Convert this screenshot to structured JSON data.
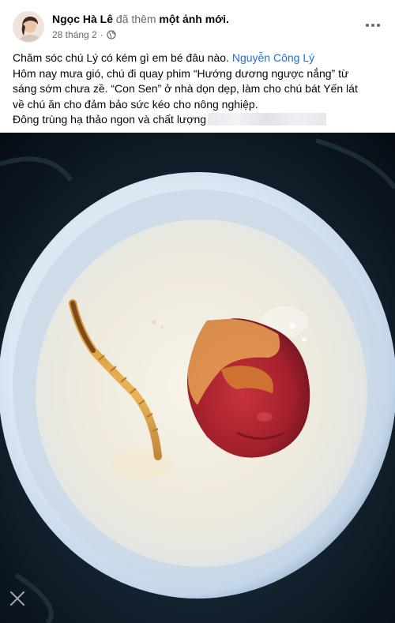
{
  "post": {
    "author": "Ngọc Hà Lê",
    "action_prefix": "đã thêm",
    "action_bold": "một ảnh mới.",
    "date": "28 tháng 2",
    "separator": "·",
    "audience_icon": "globe-icon",
    "more_icon": "more-horizontal-icon",
    "text": {
      "line1": "Chăm sóc chú Lý có kém gì em bé đâu nào.",
      "mention": "Nguyễn Công Lý",
      "line2": "Hôm nay mưa gió, chú đi quay phim “Hướng dương ngược nắng” từ",
      "line3": "sáng sớm chưa zề. “Con Sen” ở nhà dọn dẹp, làm cho chú bát Yến lát",
      "line4": "về chú ăn cho đảm bảo sức kéo cho nông nghiệp.",
      "line5": "Đông trùng hạ thảo ngon và chất lượng"
    }
  },
  "photo": {
    "subject_icons": [
      "bowl-photo",
      "cordyceps",
      "red-date"
    ],
    "corner_icon": "close-icon"
  },
  "colors": {
    "link": "#216fdb",
    "secondary_text": "#65676b",
    "photo_background": "#0c1621"
  }
}
